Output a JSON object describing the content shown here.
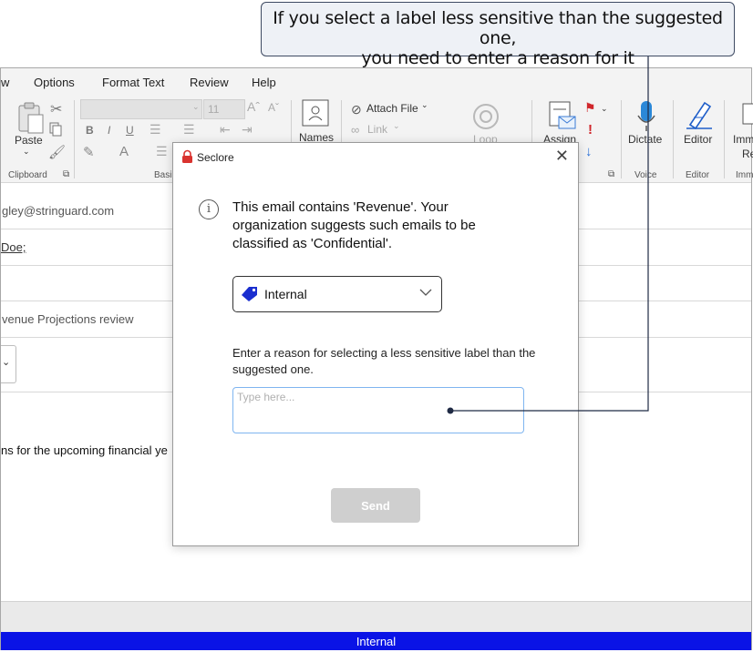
{
  "callout": {
    "line1": "If you select a label less sensitive than the suggested one,",
    "line2": "you need to enter a reason for it"
  },
  "menu": {
    "items": [
      "w",
      "Options",
      "Format Text",
      "Review",
      "Help"
    ]
  },
  "ribbon": {
    "paste_label": "Paste",
    "clipboard_label": "Clipboard",
    "basic_label": "Basi",
    "font_size": "11",
    "names_label": "Names",
    "attach_file_label": "Attach File",
    "link_label": "Link",
    "loop_label": "Loop",
    "assign_label": "Assign",
    "dictate_label": "Dictate",
    "voice_label": "Voice",
    "editor_label": "Editor",
    "editor_group_label": "Editor",
    "immersive_label_1": "Imm",
    "immersive_label_2": "Re",
    "immersive_group_label": "Imm"
  },
  "compose": {
    "from_partial": "gley@stringuard.com",
    "to_partial": "Doe;",
    "subject_partial": "venue Projections review",
    "body_partial": "ns for the upcoming financial ye"
  },
  "dialog": {
    "title": "Seclore",
    "message": "This email contains 'Revenue'. Your organization suggests such emails to be classified as 'Confidential'.",
    "selected_label": "Internal",
    "reason_prompt": "Enter a reason for selecting a less sensitive label than the suggested one.",
    "reason_placeholder": "Type here...",
    "reason_value": "",
    "send_label": "Send"
  },
  "status_bar": {
    "label": "Internal"
  },
  "colors": {
    "status_bar": "#0a13e6",
    "tag_icon": "#1a2ecf",
    "lock_icon": "#d9332f",
    "input_border": "#7fb5f0",
    "send_disabled": "#cfcfcf"
  }
}
